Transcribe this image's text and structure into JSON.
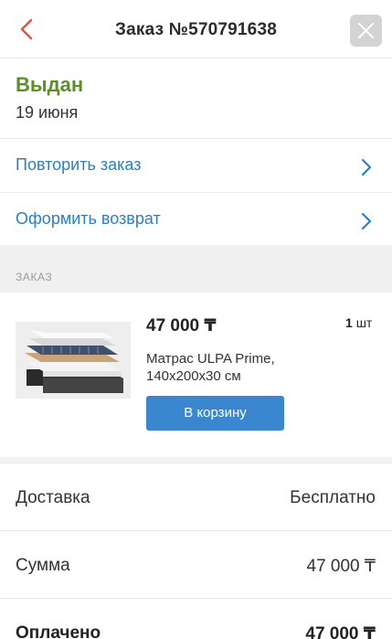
{
  "header": {
    "title": "Заказ №570791638"
  },
  "status": {
    "label": "Выдан",
    "date": "19 июня",
    "color": "#5a8f2a"
  },
  "actions": [
    {
      "label": "Повторить заказ",
      "icon": "chevron-right-icon"
    },
    {
      "label": "Оформить возврат",
      "icon": "chevron-right-icon"
    }
  ],
  "section": {
    "label": "ЗАКАЗ"
  },
  "item": {
    "price": "47 000 ₸",
    "qty_number": "1",
    "qty_unit": "шт",
    "name": "Матрас ULPA Prime, 140х200х30 см",
    "cart_button": "В корзину"
  },
  "summary": [
    {
      "label": "Доставка",
      "value": "Бесплатно"
    },
    {
      "label": "Сумма",
      "value": "47 000 ₸"
    },
    {
      "label": "Оплачено",
      "value": "47 000 ₸"
    }
  ],
  "colors": {
    "accent_link": "#2c7fbf",
    "button": "#3a87d0",
    "back_arrow": "#d9534f"
  }
}
